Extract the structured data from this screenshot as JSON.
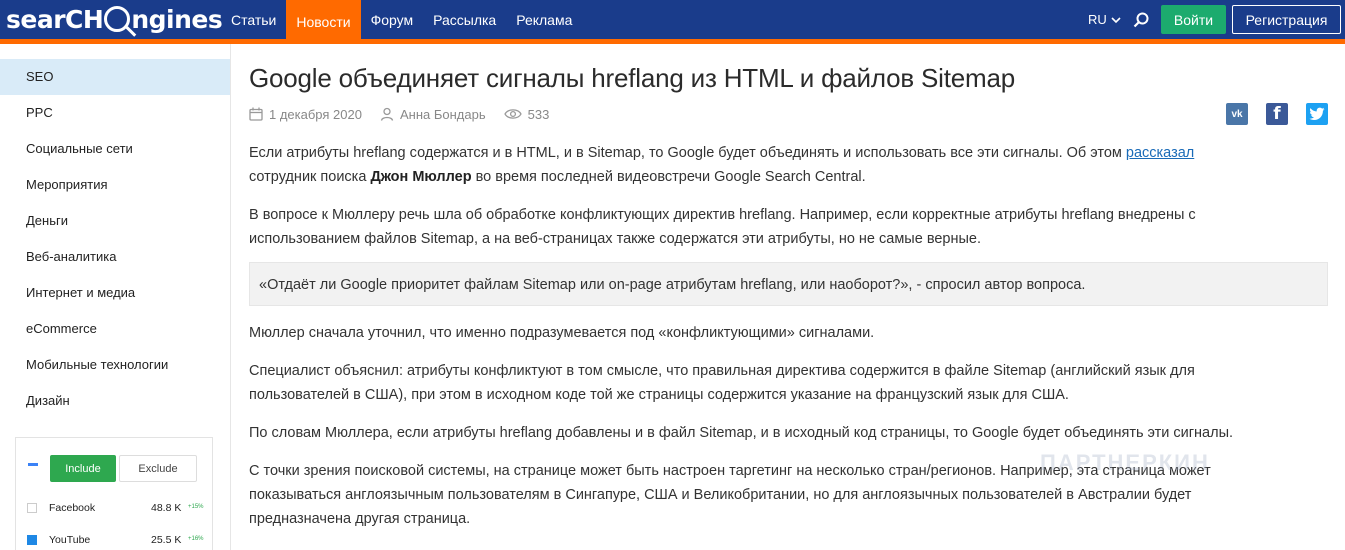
{
  "header": {
    "logo_part1": "searCH",
    "logo_part2": "ngines",
    "nav": [
      "Статьи",
      "Новости",
      "Форум",
      "Рассылка",
      "Реклама"
    ],
    "lang": "RU",
    "login": "Войти",
    "register": "Регистрация"
  },
  "sidebar": {
    "items": [
      "SEO",
      "PPC",
      "Социальные сети",
      "Мероприятия",
      "Деньги",
      "Веб-аналитика",
      "Интернет и медиа",
      "eCommerce",
      "Мобильные технологии",
      "Дизайн"
    ],
    "active": "SEO"
  },
  "widget": {
    "include": "Include",
    "exclude": "Exclude",
    "rows": [
      {
        "name": "Facebook",
        "value": "48.8 K",
        "delta": "+15%",
        "checked": false
      },
      {
        "name": "YouTube",
        "value": "25.5 K",
        "delta": "+16%",
        "checked": true
      }
    ]
  },
  "article": {
    "title": "Google объединяет сигналы hreflang из HTML и файлов Sitemap",
    "date": "1 декабря 2020",
    "author": "Анна Бондарь",
    "views": "533",
    "p1_a": "Если атрибуты hreflang содержатся и в HTML, и в Sitemap, то Google будет объединять и использовать все эти сигналы. Об этом ",
    "p1_link": "рассказал",
    "p1_b": " сотрудник поиска ",
    "p1_bold": "Джон Мюллер",
    "p1_c": " во время последней видеовстречи Google Search Central.",
    "p2": "В вопросе к Мюллеру речь шла об обработке конфликтующих директив hreflang. Например, если корректные атрибуты hreflang внедрены с использованием файлов Sitemap, а на веб-страницах также содержатся эти атрибуты, но не самые верные.",
    "quote": "«Отдаёт ли Google приоритет файлам Sitemap или on-page атрибутам hreflang, или наоборот?», - спросил автор вопроса.",
    "p3": "Мюллер сначала уточнил, что именно подразумевается под «конфликтующими» сигналами.",
    "p4": "Специалист объяснил: атрибуты конфликтуют в том смысле, что правильная директива содержится в файле Sitemap (английский язык для пользователей в США), при этом в исходном коде той же страницы содержится указание на французский язык для США.",
    "p5": "По словам Мюллера, если атрибуты hreflang добавлены и в файл Sitemap, и в исходный код страницы, то Google будет объединять эти сигналы.",
    "p6": "С точки зрения поисковой системы, на странице может быть настроен таргетинг на несколько стран/регионов. Например, эта страница может показываться англоязычным пользователям в Сингапуре, США и Великобритании, но для англоязычных пользователей в Австралии будет предназначена другая страница."
  },
  "social": [
    "vk-icon",
    "facebook-icon",
    "twitter-icon"
  ],
  "watermark": "ПАРТНЕРКИН",
  "colors": {
    "header": "#1a3c8b",
    "accent": "#ff6a00",
    "login": "#1cab6e",
    "link": "#1a6bb8"
  }
}
